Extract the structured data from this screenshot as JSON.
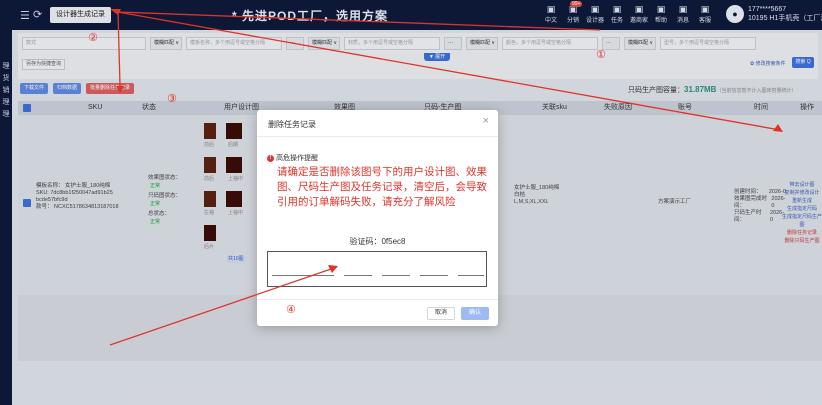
{
  "header": {
    "menu_icon": "menu-icon",
    "refresh_icon": "refresh-icon",
    "tab_label": "设计器生成记录",
    "headline": "* 先进POD工厂，选用方案",
    "tools": [
      {
        "icon": "translate-icon",
        "label": "中文"
      },
      {
        "icon": "share-icon",
        "label": "分销"
      },
      {
        "icon": "designer-icon",
        "label": "设计器"
      },
      {
        "icon": "task-icon",
        "label": "任务"
      },
      {
        "icon": "client-icon",
        "label": "邀商家"
      },
      {
        "icon": "help-icon",
        "label": "帮助"
      },
      {
        "icon": "message-icon",
        "label": "消息"
      },
      {
        "icon": "service-icon",
        "label": "客服"
      }
    ],
    "badge": "99+",
    "user_line1": "177****5667",
    "user_line2": "10195 H1手机壳（工厂演..."
  },
  "leftnav": [
    "理",
    "货",
    "销",
    "理",
    "理"
  ],
  "filters": {
    "row": [
      {
        "type": "box",
        "text": "款式"
      },
      {
        "type": "sel",
        "text": "模糊匹配 ∨"
      },
      {
        "type": "box",
        "text": "模板名称，多个用逗号或空格分隔"
      },
      {
        "type": "sel",
        "text": "···"
      },
      {
        "type": "sel",
        "text": "模糊匹配 ∨"
      },
      {
        "type": "box",
        "text": "材质，多个用逗号或空格分隔"
      },
      {
        "type": "sel",
        "text": "···"
      },
      {
        "type": "sel",
        "text": "模糊匹配 ∨"
      },
      {
        "type": "box",
        "text": "颜色，多个用逗号或空格分隔"
      },
      {
        "type": "sel",
        "text": "···"
      },
      {
        "type": "sel",
        "text": "模糊匹配 ∨"
      },
      {
        "type": "box",
        "text": "型号，多个用逗号或空格分隔"
      }
    ],
    "save_query": "另存为快捷查询",
    "expand": "▼ 展开",
    "recent": "✿ 修改搜索条件",
    "search_button": "搜索 Q"
  },
  "actions": [
    {
      "label": "下载文件",
      "color": "blue"
    },
    {
      "label": "归档数据",
      "color": "blue"
    },
    {
      "label": "批量删除任务记录",
      "color": "red"
    }
  ],
  "storage": {
    "label": "只码生产图容量：",
    "value": "31.87MB",
    "note": "（当前信息暂不计入图床容量统计）"
  },
  "table": {
    "headers": [
      "SKU",
      "状态",
      "用户设计图",
      "效果图",
      "只码-生产图",
      "关联sku",
      "失败原因",
      "账号",
      "时间",
      "操作"
    ],
    "row": {
      "sku_lines": [
        "模板名称：  女护士服_180纯棉",
        "SKU:         7dc8bb1f250047ad91b25",
        "                bcde57bfc9d",
        "款号：       NCXC5178634813187018"
      ],
      "status_lines": [
        {
          "label": "效果图状态：",
          "tag": "正常"
        },
        {
          "label": "只码图状态：",
          "tag": "正常"
        },
        {
          "label": "总状态：",
          "tag": "正常"
        }
      ],
      "design_labels": [
        "前后",
        "后期",
        "前后",
        "上袖中",
        "左袖",
        "上袖中",
        "后片"
      ],
      "design_more": "共10图",
      "linked_sku": [
        "女护士服_180纯棉",
        "白桔",
        "L,M,S,XL,XXL"
      ],
      "account": "方案演示工厂",
      "time_lines": [
        {
          "label": "创建时间：",
          "value": "2026-0"
        },
        {
          "label": "效果图完成时间：",
          "value": "2026-0"
        },
        {
          "label": "只码生产时间：",
          "value": "2026-0"
        }
      ],
      "ops": [
        {
          "label": "带去设计图",
          "danger": false
        },
        {
          "label": "复制并修改设计",
          "danger": false
        },
        {
          "label": "重新生成",
          "danger": false
        },
        {
          "label": "生成指定尺码",
          "danger": false
        },
        {
          "label": "生成指定尺码生产图",
          "danger": false
        },
        {
          "label": "删除任务记录",
          "danger": true
        },
        {
          "label": "删除只码生产图",
          "danger": true
        }
      ]
    }
  },
  "modal": {
    "title": "删除任务记录",
    "close": "×",
    "warn_label": "高危操作提醒",
    "warn_icon": "!",
    "message": "请确定是否删除该图号下的用户设计图、效果图、尺码生产图及任务记录，清空后，会导致引用的订单解码失败，请充分了解风险",
    "verify_label": "验证码：0f5ec8",
    "cancel": "取消",
    "confirm": "确认"
  },
  "annotations": [
    "②",
    "③",
    "①",
    "④"
  ],
  "colors": {
    "annotation": "#e0342a",
    "primary": "#3d6fd6",
    "header": "#0e1a3a"
  }
}
